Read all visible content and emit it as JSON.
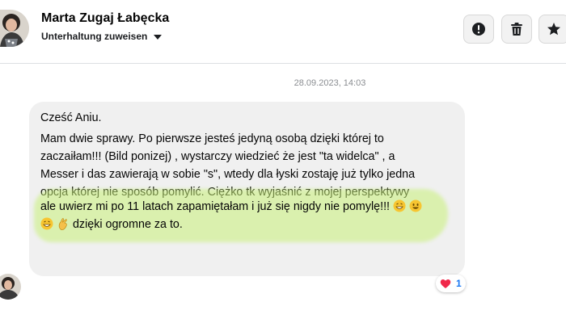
{
  "header": {
    "contact_name": "Marta Zugaj Łabęcka",
    "assign_label": "Unterhaltung zuweisen",
    "actions": [
      "report",
      "delete",
      "star"
    ]
  },
  "conversation": {
    "date_separator": "28.09.2023, 14:03",
    "message": {
      "greeting": "Cześć Aniu.",
      "lines": [
        "Mam dwie sprawy. Po pierwsze jesteś jedyną osobą dzięki której to",
        "zaczaiłam!!! (Bild ponizej) , wystarczy wiedzieć że jest \"ta widelca\" , a",
        "Messer i das zawierają w sobie \"s\", wtedy dla łyski zostaję już tylko jedna",
        "opcja której nie sposób pomylić. Ciężko tk wyjaśnić z mojej perspektywy",
        "ale uwierz mi po 11 latach zapamiętałam i już się nigdy nie pomylę!!!",
        "dzięki ogromne za to."
      ]
    },
    "reaction": {
      "icon": "heart-icon",
      "count": "1"
    }
  },
  "colors": {
    "highlight": "#c8f078",
    "bubble": "#f0f0f0",
    "reaction_count": "#1877f2",
    "heart": "#f0284a"
  }
}
